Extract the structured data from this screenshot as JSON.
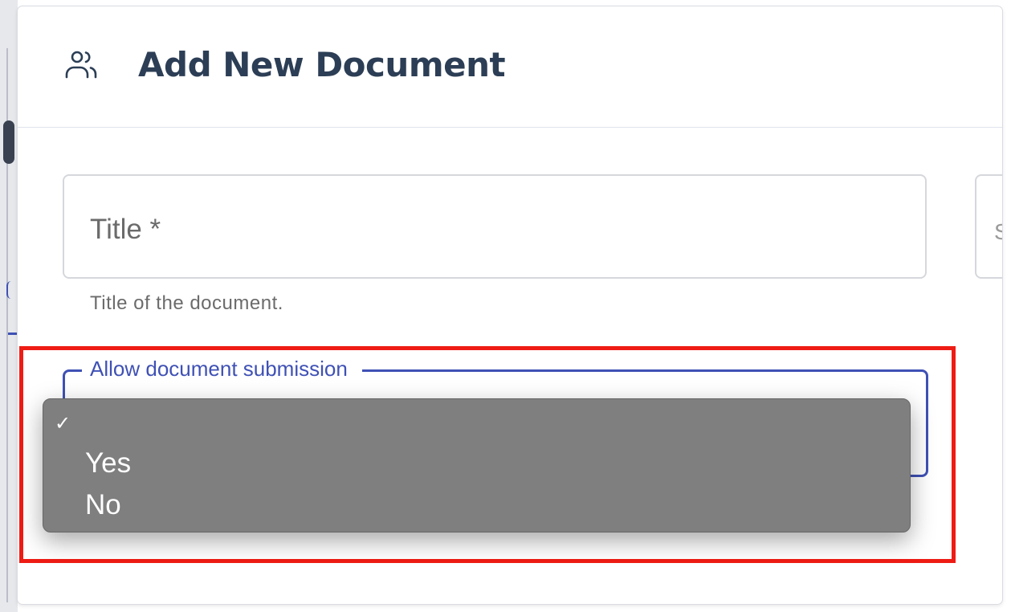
{
  "dialog": {
    "title": "Add New Document",
    "icon": "people-icon"
  },
  "title_field": {
    "placeholder": "Title *",
    "helper": "Title of the document.",
    "value": ""
  },
  "second_field": {
    "placeholder_glyph": "S"
  },
  "submission_select": {
    "label": "Allow document submission",
    "selected_value": "",
    "options": [
      {
        "label": "",
        "checked": true
      },
      {
        "label": "Yes",
        "checked": false
      },
      {
        "label": "No",
        "checked": false
      }
    ],
    "check_glyph": "✓"
  },
  "colors": {
    "accent": "#3f51b5",
    "highlight": "#ee1c14",
    "title": "#2c3e55",
    "menu_bg": "#7f7f80"
  }
}
